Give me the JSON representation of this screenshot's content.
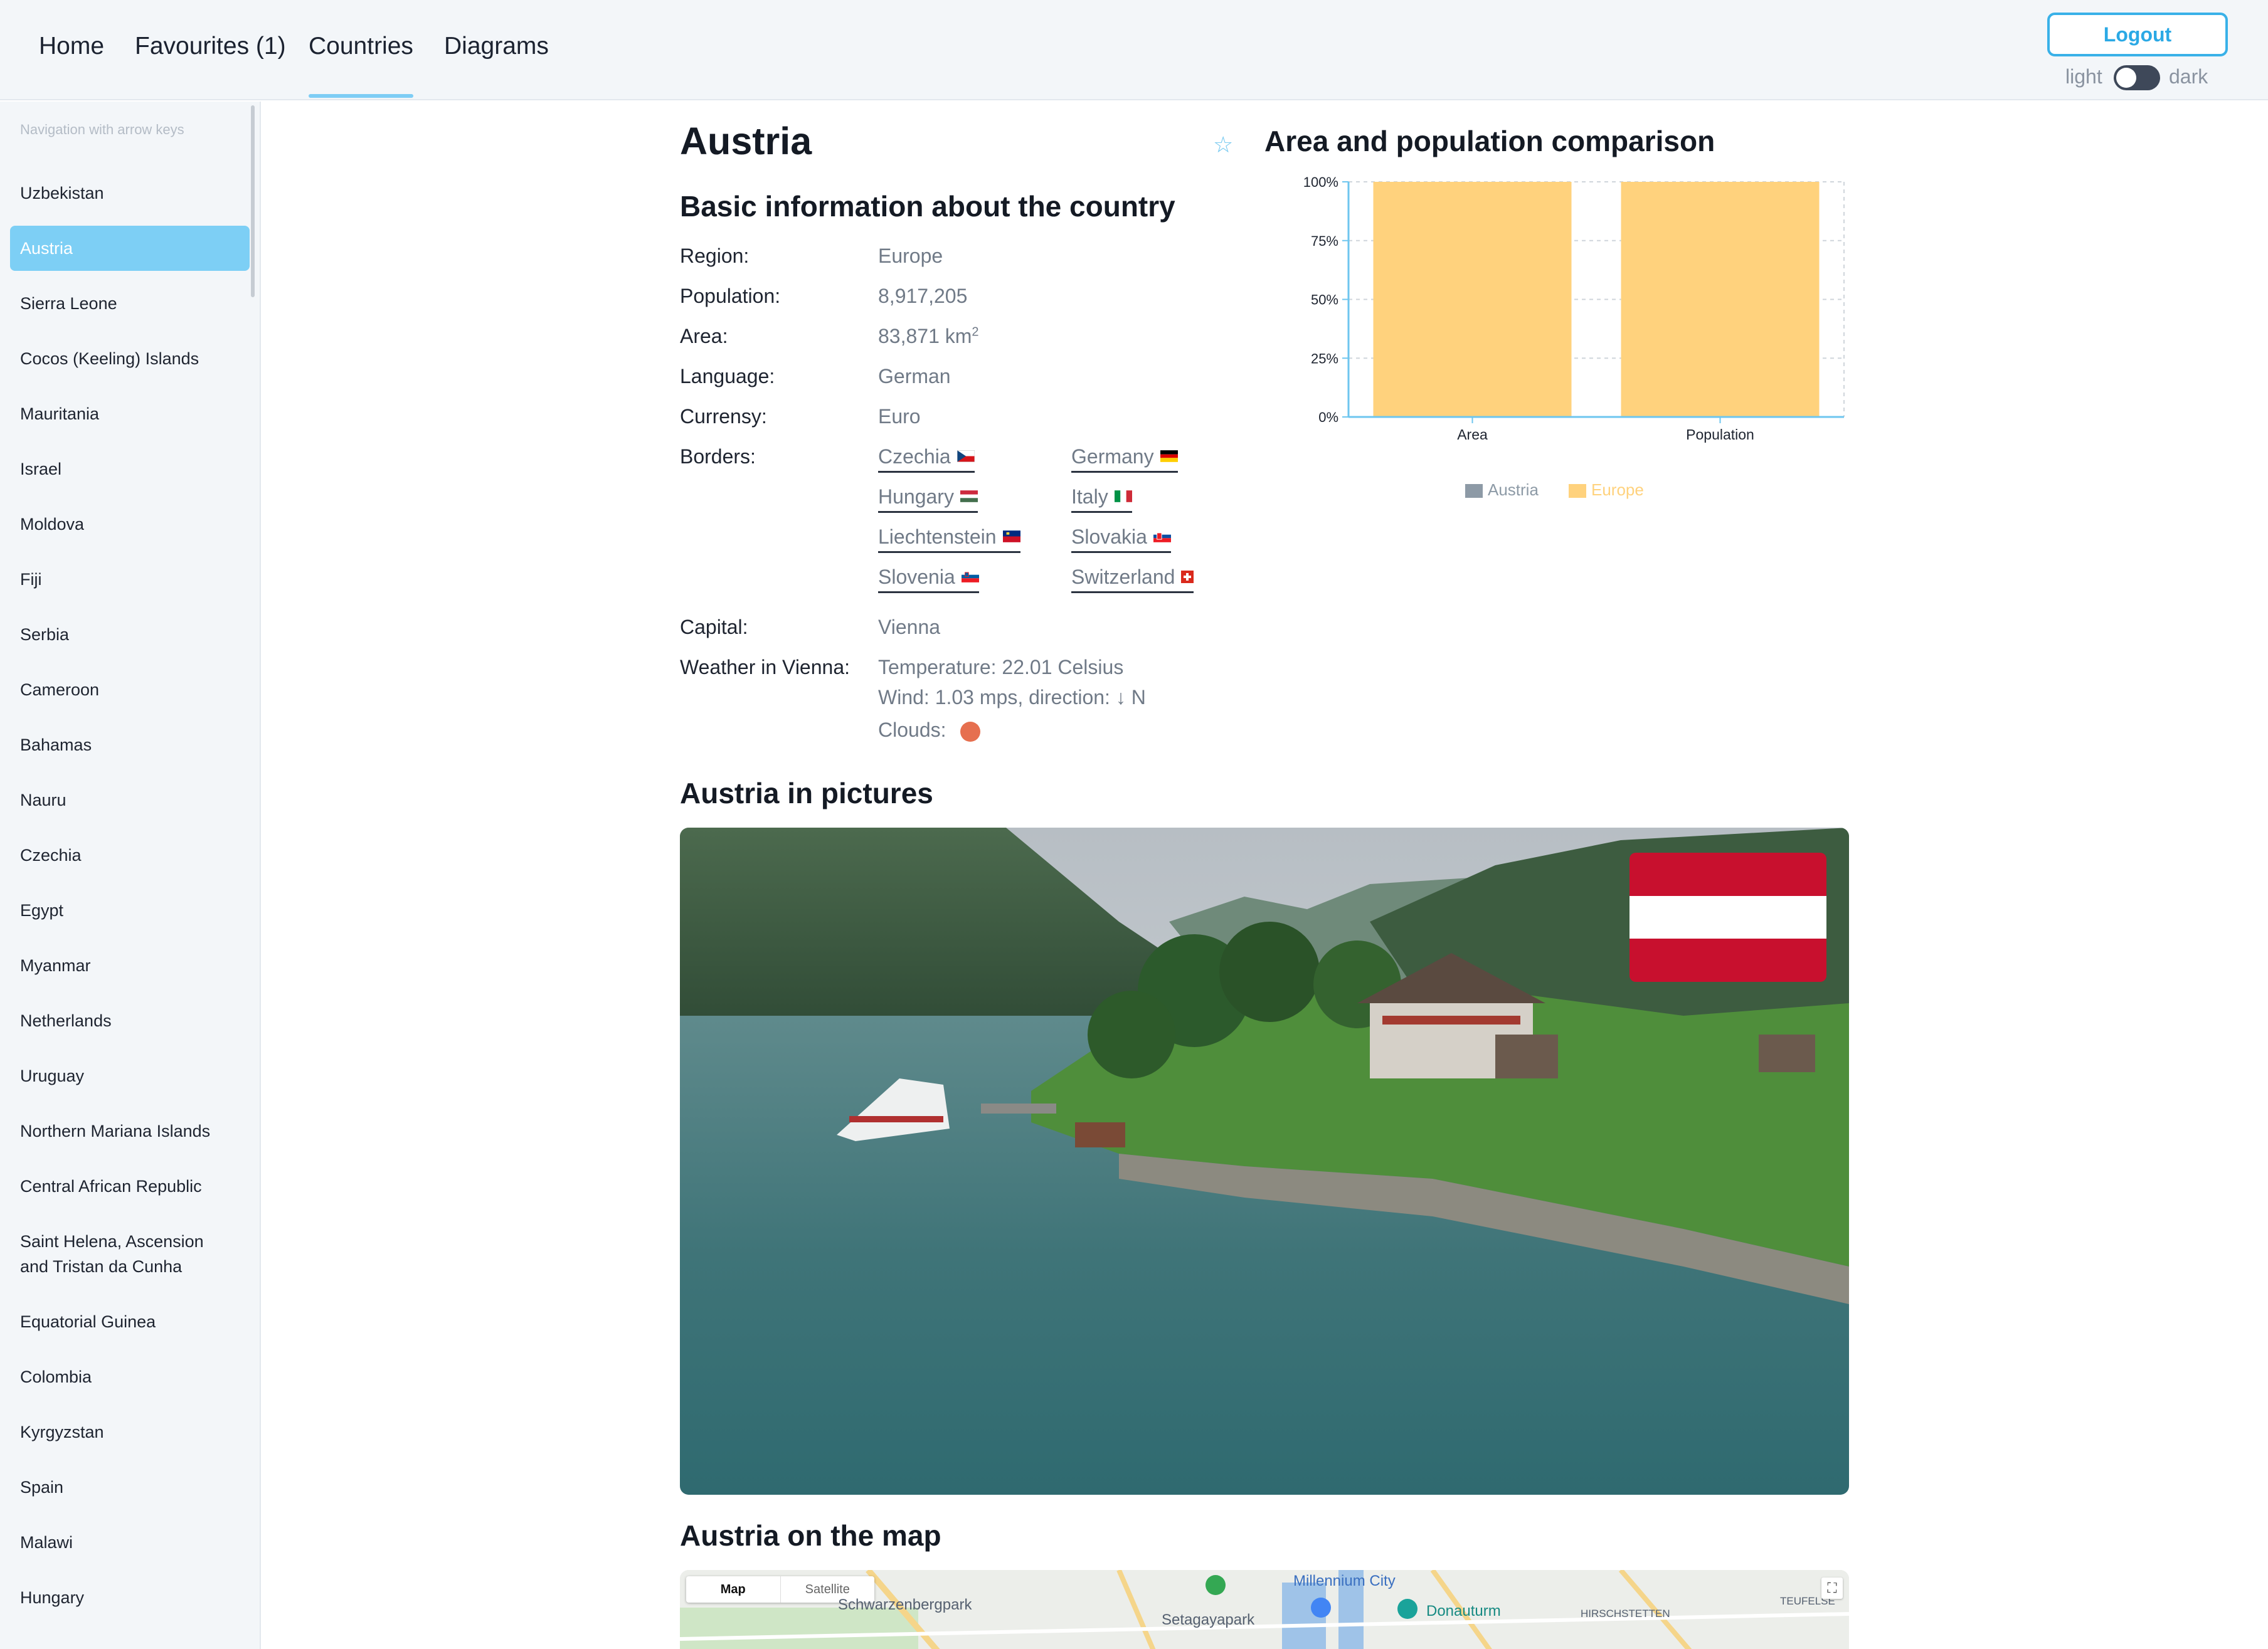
{
  "nav": {
    "tabs": [
      {
        "label": "Home"
      },
      {
        "label": "Favourites (1)"
      },
      {
        "label": "Countries",
        "active": true
      },
      {
        "label": "Diagrams"
      }
    ],
    "logout_label": "Logout",
    "theme": {
      "light_label": "light",
      "dark_label": "dark",
      "mode": "light"
    }
  },
  "sidebar": {
    "hint": "Navigation with arrow keys",
    "selected": "Austria",
    "countries": [
      "Uzbekistan",
      "Austria",
      "Sierra Leone",
      "Cocos (Keeling) Islands",
      "Mauritania",
      "Israel",
      "Moldova",
      "Fiji",
      "Serbia",
      "Cameroon",
      "Bahamas",
      "Nauru",
      "Czechia",
      "Egypt",
      "Myanmar",
      "Netherlands",
      "Uruguay",
      "Northern Mariana Islands",
      "Central African Republic",
      "Saint Helena, Ascension",
      "and Tristan da Cunha",
      "Equatorial Guinea",
      "Colombia",
      "Kyrgyzstan",
      "Spain",
      "Malawi",
      "Hungary"
    ]
  },
  "country": {
    "name": "Austria",
    "basic_title": "Basic information about the country",
    "labels": {
      "region": "Region:",
      "population": "Population:",
      "area": "Area:",
      "language": "Language:",
      "currency": "Currensy:",
      "borders": "Borders:",
      "capital": "Capital:",
      "weather": "Weather in Vienna:"
    },
    "region": "Europe",
    "population": "8,917,205",
    "area": "83,871 km",
    "area_unit_sup": "2",
    "language": "German",
    "currency": "Euro",
    "borders": [
      {
        "name": "Czechia",
        "flag": "cz"
      },
      {
        "name": "Germany",
        "flag": "de"
      },
      {
        "name": "Hungary",
        "flag": "hu"
      },
      {
        "name": "Italy",
        "flag": "it"
      },
      {
        "name": "Liechtenstein",
        "flag": "li"
      },
      {
        "name": "Slovakia",
        "flag": "sk"
      },
      {
        "name": "Slovenia",
        "flag": "si"
      },
      {
        "name": "Switzerland",
        "flag": "ch"
      }
    ],
    "capital": "Vienna",
    "weather": {
      "temperature": "Temperature: 22.01 Celsius",
      "wind": "Wind: 1.03 mps, direction: ↓ N",
      "clouds_label": "Clouds:"
    }
  },
  "chart_title": "Area and population comparison",
  "chart_data": {
    "type": "bar",
    "stacked": true,
    "categories": [
      "Area",
      "Population"
    ],
    "series": [
      {
        "name": "Austria",
        "values": [
          0.0,
          0.0
        ],
        "color": "#8d9aa6"
      },
      {
        "name": "Europe",
        "values": [
          100,
          100
        ],
        "color": "#ffd27d"
      }
    ],
    "yticks": [
      "0%",
      "25%",
      "50%",
      "75%",
      "100%"
    ],
    "ylim": [
      0,
      100
    ],
    "grid": true,
    "legend": "bottom"
  },
  "pictures_title": "Austria in pictures",
  "map_title": "Austria on the map",
  "map": {
    "map_label": "Map",
    "satellite_label": "Satellite",
    "places": [
      "Schwarzenbergpark",
      "Setagayapark",
      "Millennium City",
      "Donauturm",
      "HIRSCHSTETTEN",
      "TEUFELSE"
    ]
  },
  "colors": {
    "accent": "#39b1e8",
    "selected_country_bg": "#7dcff5",
    "europe_bar": "#ffd27d",
    "austria_bar": "#8d9aa6",
    "flag_red": "#c8102e"
  }
}
